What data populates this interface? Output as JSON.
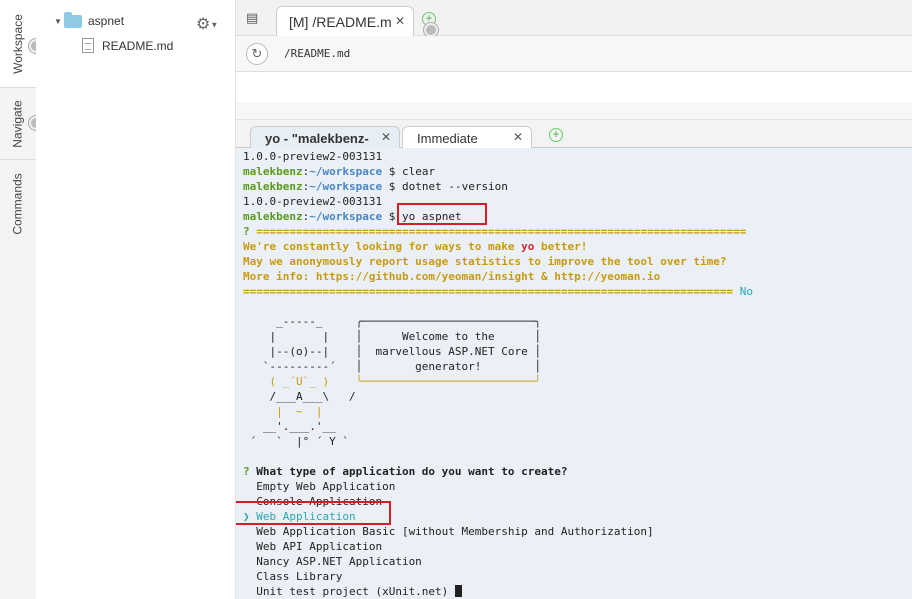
{
  "sidebar_tabs": [
    "Workspace",
    "Navigate",
    "Commands"
  ],
  "tree": {
    "folder": "aspnet",
    "file": "README.md"
  },
  "editor": {
    "tab_label": "[M] /README.m",
    "path": "/README.md"
  },
  "terminal_tabs": {
    "active": "yo - \"malekbenz-",
    "second": "Immediate"
  },
  "terminal": {
    "line0": "1.0.0-preview2-003131",
    "prompt_user": "malekbenz",
    "prompt_sep": ":",
    "prompt_path": "~/workspace",
    "prompt_dollar": " $ ",
    "cmd1": "clear",
    "cmd2": "dotnet --version",
    "line3": "1.0.0-preview2-003131",
    "cmd3": "yo aspnet",
    "q_mark": "?",
    "sep_line": " ==========================================================================",
    "info1_pre": "We're constantly looking for ways to make ",
    "info1_yo": "yo",
    "info1_post": " better!",
    "info2": "May we anonymously report usage statistics to improve the tool over time?",
    "info3": "More info: https://github.com/yeoman/insight & http://yeoman.io",
    "sep_line2": "========================================================================== ",
    "answer_no": "No",
    "ascii": [
      "     _-----_     ╭──────────────────────────╮",
      "    |       |    │      Welcome to the      │",
      "    |--(o)--|    │  marvellous ASP.NET Core │",
      "   `---------´   │        generator!        │",
      "    ( _´U`_ )    ╰──────────────────────────╯",
      "    /___A___\\   /",
      "     |  ~  |",
      "   __'.___.'__",
      " ´   `  |° ´ Y `"
    ],
    "question": " What type of application do you want to create?",
    "options": [
      "  Empty Web Application",
      "  Console Application",
      "Web Application",
      "  Web Application Basic [without Membership and Authorization]",
      "  Web API Application",
      "  Nancy ASP.NET Application",
      "  Class Library",
      "  Unit test project (xUnit.net) "
    ],
    "selector": "❯ "
  }
}
